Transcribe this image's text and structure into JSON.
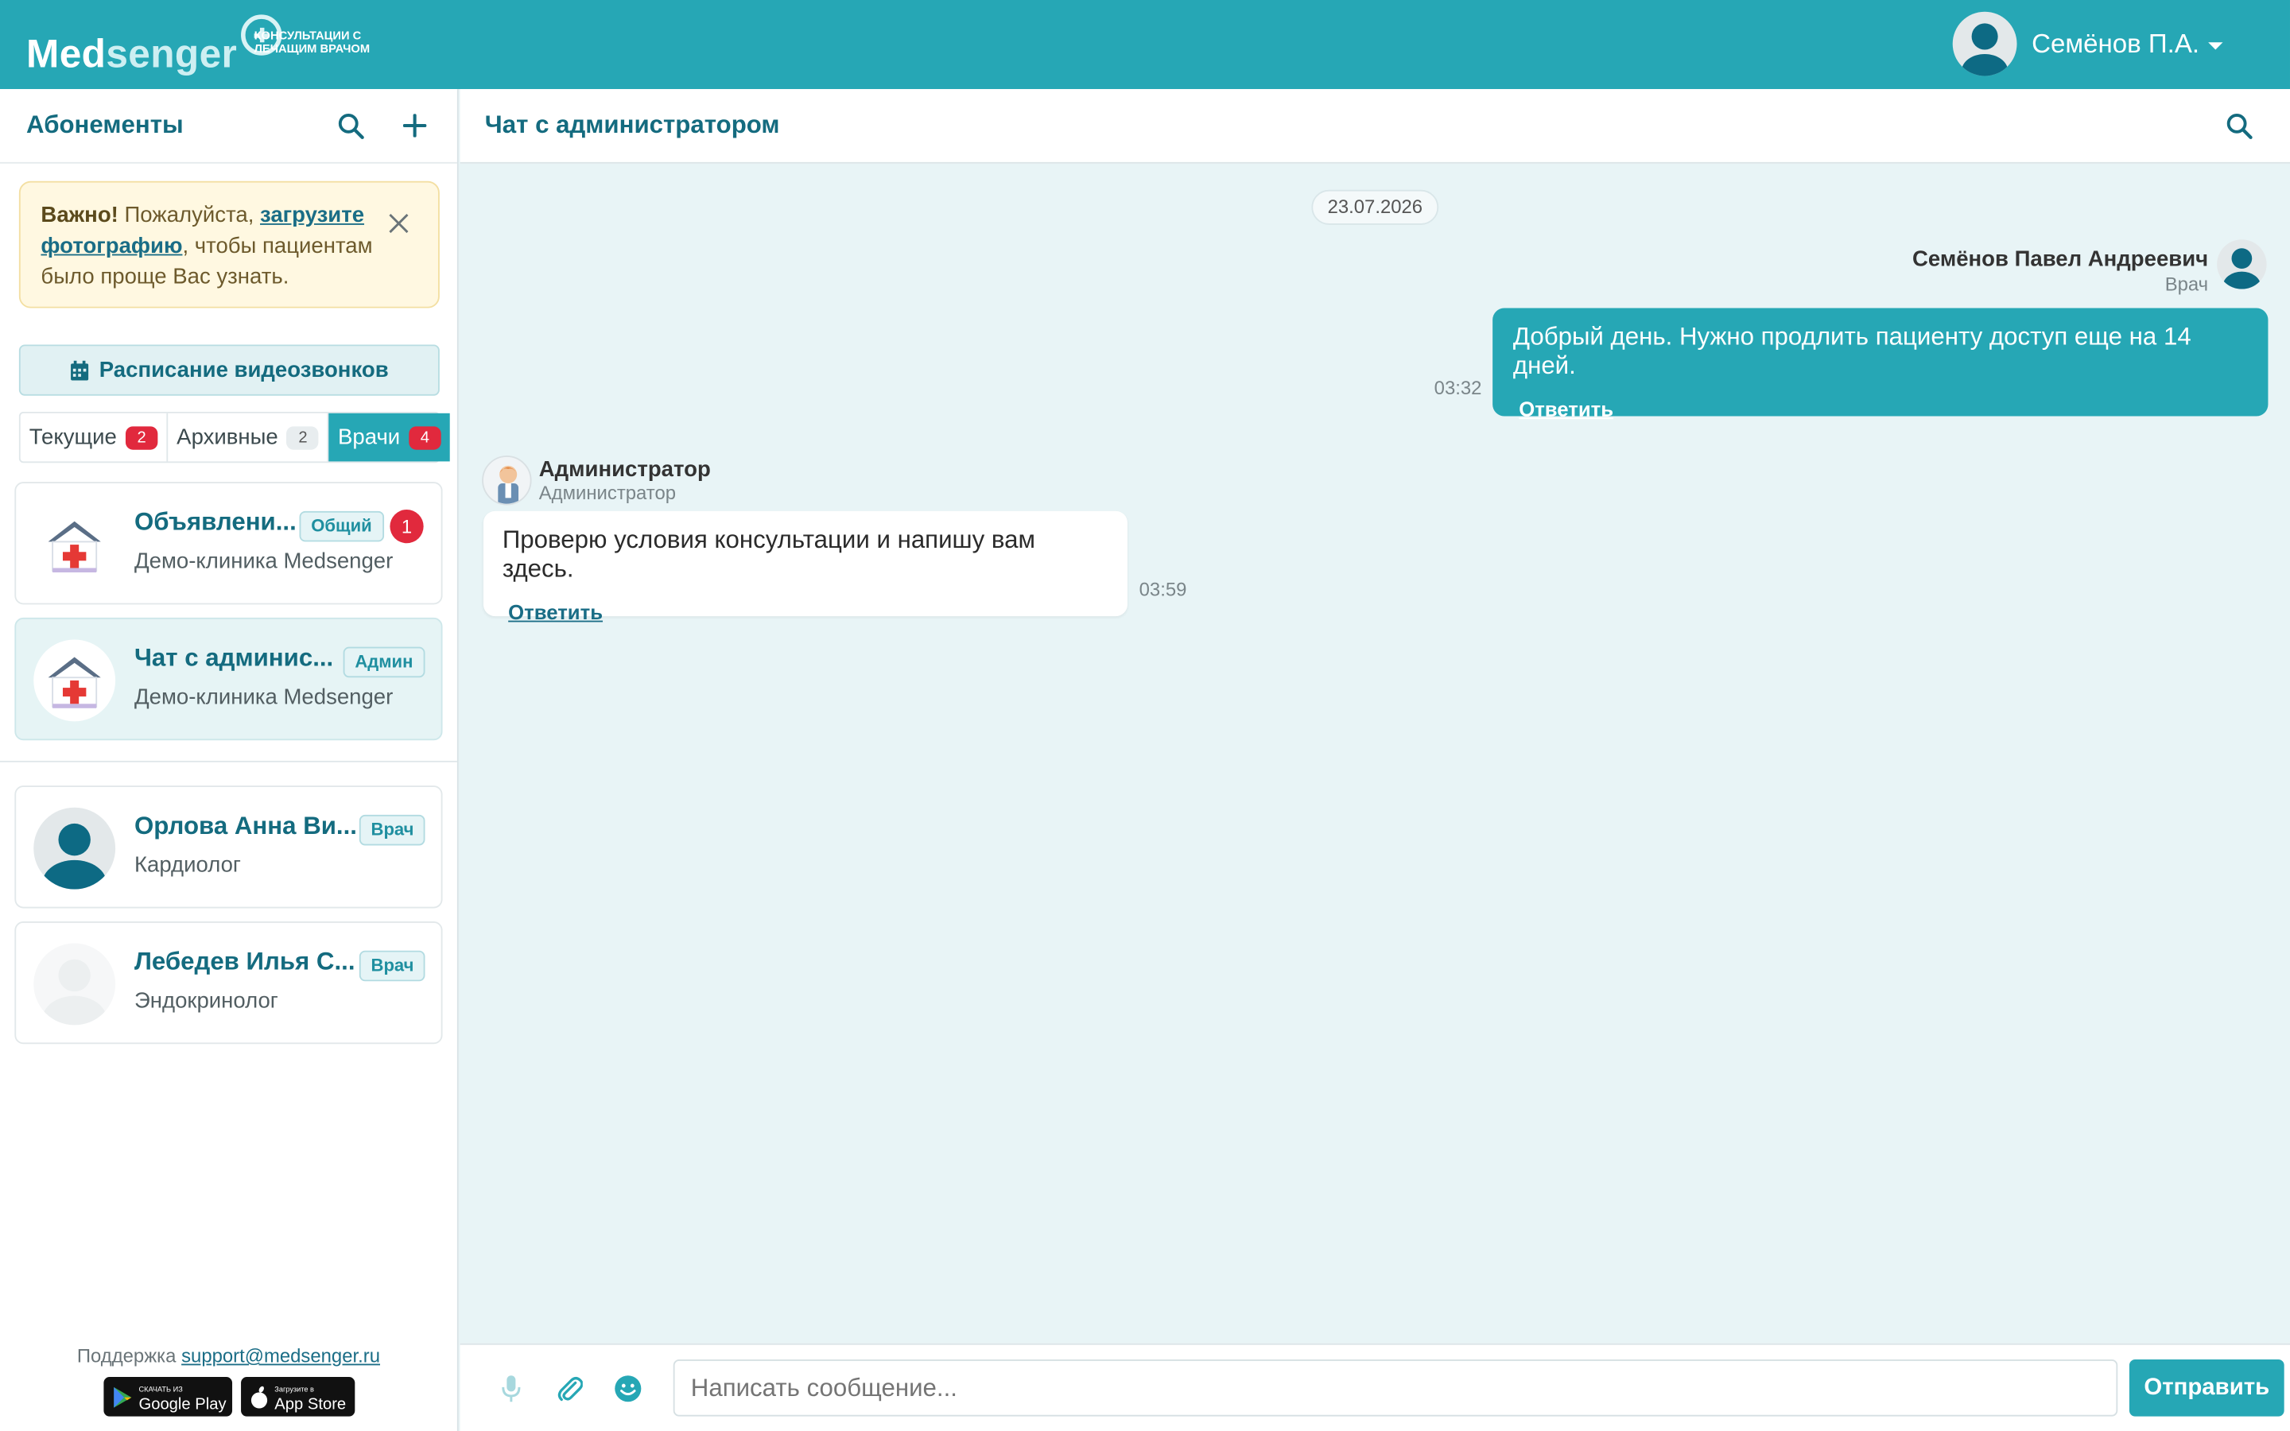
{
  "header": {
    "logo_main": "Med",
    "logo_accent": "senger",
    "logo_tagline": "КОНСУЛЬТАЦИИ С ЛЕЧАЩИМ ВРАЧОМ",
    "user_name": "Семёнов П.А."
  },
  "sidebar": {
    "title": "Абонементы",
    "alert": {
      "strong": "Важно!",
      "text_before": " Пожалуйста, ",
      "link": "загрузите фотографию",
      "text_after": ", чтобы пациентам было проще Вас узнать."
    },
    "schedule_button": "Расписание видеозвонков",
    "tabs": [
      {
        "label": "Текущие",
        "count": "2"
      },
      {
        "label": "Архивные",
        "count": "2"
      },
      {
        "label": "Врачи",
        "count": "4"
      }
    ],
    "chats": [
      {
        "title": "Объявлени...",
        "tag": "Общий",
        "subtitle": "Демо-клиника Medsenger",
        "unread": "1"
      },
      {
        "title": "Чат с админис...",
        "tag": "Админ",
        "subtitle": "Демо-клиника Medsenger"
      },
      {
        "title": "Орлова Анна Ви...",
        "tag": "Врач",
        "subtitle": "Кардиолог"
      },
      {
        "title": "Лебедев Илья С...",
        "tag": "Врач",
        "subtitle": "Эндокринолог"
      }
    ],
    "support_label": "Поддержка",
    "support_email": "support@medsenger.ru",
    "stores": [
      {
        "small": "СКАЧАТЬ ИЗ",
        "big": "Google Play"
      },
      {
        "small": "Загрузите в",
        "big": "App Store"
      }
    ]
  },
  "chat": {
    "title": "Чат с администратором",
    "date": "23.07.2026",
    "messages": [
      {
        "sender": "Семёнов Павел Андреевич",
        "role": "Врач",
        "text": "Добрый день. Нужно продлить пациенту доступ еще на 14 дней.",
        "time": "03:32",
        "reply": "Ответить"
      },
      {
        "sender": "Администратор",
        "role": "Администратор",
        "text": "Проверю условия консультации и напишу вам здесь.",
        "time": "03:59",
        "reply": "Ответить"
      }
    ],
    "input_placeholder": "Написать сообщение...",
    "send_label": "Отправить"
  },
  "colors": {
    "brand": "#26a7b5",
    "title": "#146b7f",
    "badge_red": "#e1293d",
    "alert_bg": "#fff8e1"
  }
}
